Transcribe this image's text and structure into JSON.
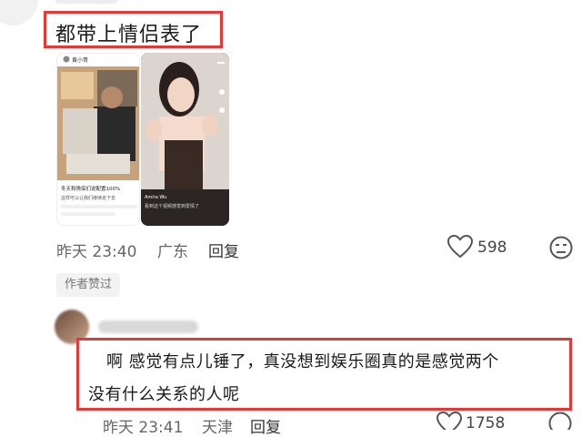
{
  "comment1": {
    "text": "都带上情侣表了",
    "time": "昨天 23:40",
    "location": "广东",
    "reply_label": "回复",
    "like_count": "598",
    "author_badge": "作者赞过",
    "left_image": {
      "header": "黄小哥",
      "caption": "冬天和情侣们说配置100%",
      "sub": "这样可以让我们继续走下去"
    },
    "right_image": {
      "caption": "Amira Wu",
      "sub": "看到这个视频感觉到爱情了"
    }
  },
  "comment2": {
    "line1": "啊 感觉有点儿锤了，真没想到娱乐圈真的是感觉两个",
    "line2": "没有什么关系的人呢",
    "time": "昨天 23:41",
    "location": "天津",
    "reply_label": "回复",
    "like_count": "1758"
  },
  "colors": {
    "highlight_border": "#e53935",
    "meta_text": "#666666",
    "badge_bg": "#f2f2f2"
  }
}
